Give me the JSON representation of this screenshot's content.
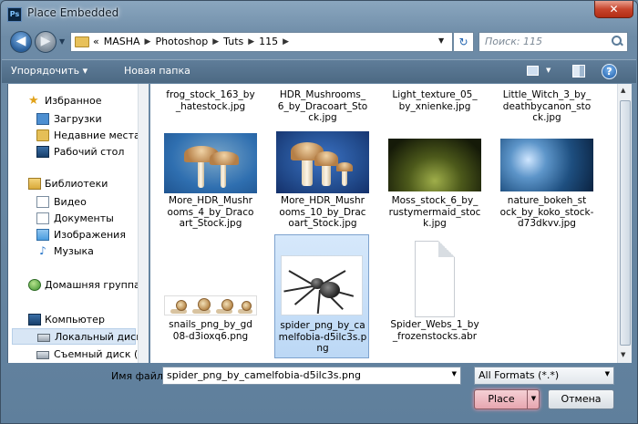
{
  "window": {
    "title": "Place Embedded",
    "app_icon": "photoshop-icon",
    "close_label": "✕"
  },
  "nav": {
    "back_label": "◀",
    "forward_label": "▶",
    "history_drop": "▼",
    "breadcrumb": [
      "«",
      "MASHA",
      "Photoshop",
      "Tuts",
      "115"
    ],
    "address_drop": "▼",
    "refresh_label": "↻",
    "search_placeholder": "Поиск: 115"
  },
  "toolbar": {
    "organize": "Упорядочить ▾",
    "new_folder": "Новая папка",
    "help": "?",
    "view_drop": "▼"
  },
  "sidebar": {
    "items": [
      {
        "label": "Избранное",
        "icon": "star-icon"
      },
      {
        "label": "Загрузки",
        "icon": "downloads-folder-icon"
      },
      {
        "label": "Недавние места",
        "icon": "recent-places-icon"
      },
      {
        "label": "Рабочий стол",
        "icon": "desktop-icon"
      },
      {
        "label": "Библиотеки",
        "icon": "libraries-icon"
      },
      {
        "label": "Видео",
        "icon": "video-library-icon"
      },
      {
        "label": "Документы",
        "icon": "documents-library-icon"
      },
      {
        "label": "Изображения",
        "icon": "pictures-library-icon"
      },
      {
        "label": "Музыка",
        "icon": "music-library-icon"
      },
      {
        "label": "Домашняя группа",
        "icon": "homegroup-icon"
      },
      {
        "label": "Компьютер",
        "icon": "computer-icon"
      },
      {
        "label": "Локальный диск",
        "icon": "local-disk-icon"
      },
      {
        "label": "Съемный диск (E",
        "icon": "removable-disk-icon"
      }
    ],
    "selected_index": 11
  },
  "files": [
    {
      "name_lines": [
        "frog_stock_163_by",
        "_hatestock.jpg"
      ],
      "thumb": "none"
    },
    {
      "name_lines": [
        "HDR_Mushrooms_",
        "6_by_Dracoart_Sto",
        "ck.jpg"
      ],
      "thumb": "none"
    },
    {
      "name_lines": [
        "Light_texture_05_",
        "by_xnienke.jpg"
      ],
      "thumb": "none"
    },
    {
      "name_lines": [
        "Little_Witch_3_by_",
        "deathbycanon_sto",
        "ck.jpg"
      ],
      "thumb": "none"
    },
    {
      "name_lines": [
        "More_HDR_Mushr",
        "ooms_4_by_Draco",
        "art_Stock.jpg"
      ],
      "thumb": "mushrooms-blue"
    },
    {
      "name_lines": [
        "More_HDR_Mushr",
        "ooms_10_by_Drac",
        "oart_Stock.jpg"
      ],
      "thumb": "mushrooms-dark-blue"
    },
    {
      "name_lines": [
        "Moss_stock_6_by_",
        "rustymermaid_stoc",
        "k.jpg"
      ],
      "thumb": "moss"
    },
    {
      "name_lines": [
        "nature_bokeh_st",
        "ock_by_koko_stock-",
        "d73dkvv.jpg"
      ],
      "thumb": "bokeh"
    },
    {
      "name_lines": [
        "snails_png_by_gd",
        "08-d3ioxq6.png"
      ],
      "thumb": "snails"
    },
    {
      "name_lines": [
        "spider_png_by_ca",
        "melfobia-d5ilc3s.p",
        "ng"
      ],
      "thumb": "spider",
      "selected": true
    },
    {
      "name_lines": [
        "Spider_Webs_1_by",
        "_frozenstocks.abr"
      ],
      "thumb": "document"
    }
  ],
  "footer": {
    "filename_label": "Имя файла:",
    "filename_value": "spider_png_by_camelfobia-d5ilc3s.png",
    "format_value": "All Formats (*.*)",
    "place_label": "Place",
    "cancel_label": "Отмена",
    "drop": "▼"
  },
  "colors": {
    "selection": "#bcd8f5",
    "accent_place": "#e7a6b0",
    "chrome": "#6d8ba6"
  }
}
